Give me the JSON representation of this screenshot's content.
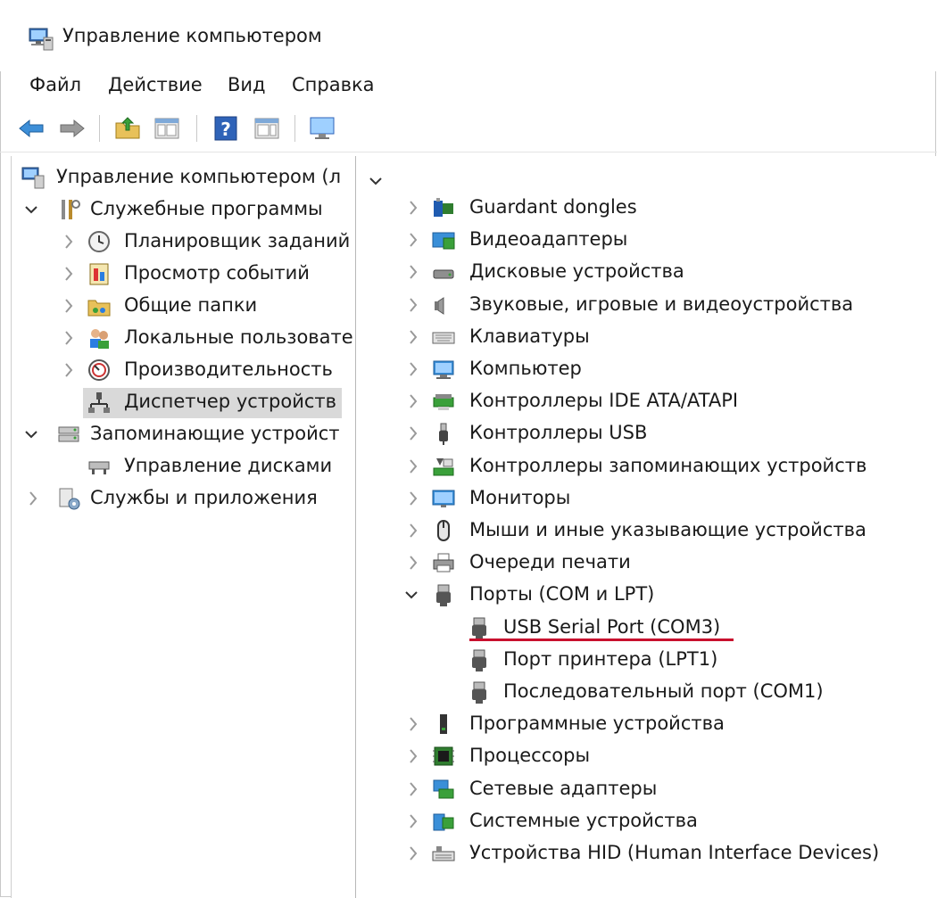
{
  "window": {
    "title": "Управление компьютером"
  },
  "menu": [
    "Файл",
    "Действие",
    "Вид",
    "Справка"
  ],
  "toolbar": {
    "buttons": [
      "back-icon",
      "forward-icon",
      "up-folder-icon",
      "show-hide-tree-icon",
      "help-icon",
      "show-hide-action-pane-icon",
      "monitor-icon"
    ]
  },
  "tree": {
    "root": "Управление компьютером (л",
    "groups": [
      {
        "label": "Служебные программы",
        "expanded": true,
        "children": [
          "Планировщик заданий",
          "Просмотр событий",
          "Общие папки",
          "Локальные пользовате",
          "Производительность",
          "Диспетчер устройств"
        ],
        "selected_index": 5
      },
      {
        "label": "Запоминающие устройст",
        "expanded": true,
        "children": [
          "Управление дисками"
        ]
      },
      {
        "label": "Службы и приложения",
        "expanded": false,
        "children": []
      }
    ]
  },
  "devices": {
    "categories": [
      {
        "label": "Guardant dongles",
        "icon": "dongle-icon"
      },
      {
        "label": "Видеоадаптеры",
        "icon": "display-adapter-icon"
      },
      {
        "label": "Дисковые устройства",
        "icon": "disk-drive-icon"
      },
      {
        "label": "Звуковые, игровые и видеоустройства",
        "icon": "speaker-icon"
      },
      {
        "label": "Клавиатуры",
        "icon": "keyboard-icon"
      },
      {
        "label": "Компьютер",
        "icon": "computer-icon"
      },
      {
        "label": "Контроллеры IDE ATA/ATAPI",
        "icon": "ide-controller-icon"
      },
      {
        "label": "Контроллеры USB",
        "icon": "usb-icon"
      },
      {
        "label": "Контроллеры запоминающих устройств",
        "icon": "storage-controller-icon"
      },
      {
        "label": "Мониторы",
        "icon": "monitor-icon"
      },
      {
        "label": "Мыши и иные указывающие устройства",
        "icon": "mouse-icon"
      },
      {
        "label": "Очереди печати",
        "icon": "printer-icon"
      },
      {
        "label": "Порты (COM и LPT)",
        "icon": "port-icon",
        "expanded": true,
        "children": [
          "USB Serial Port (COM3)",
          "Порт принтера (LPT1)",
          "Последовательный порт (COM1)"
        ]
      },
      {
        "label": "Программные устройства",
        "icon": "software-device-icon"
      },
      {
        "label": "Процессоры",
        "icon": "processor-icon"
      },
      {
        "label": "Сетевые адаптеры",
        "icon": "network-adapter-icon"
      },
      {
        "label": "Системные устройства",
        "icon": "system-device-icon"
      },
      {
        "label": "Устройства HID (Human Interface Devices)",
        "icon": "hid-icon"
      }
    ],
    "highlighted_child": "USB Serial Port (COM3)",
    "highlight_color": "#c8102e"
  }
}
